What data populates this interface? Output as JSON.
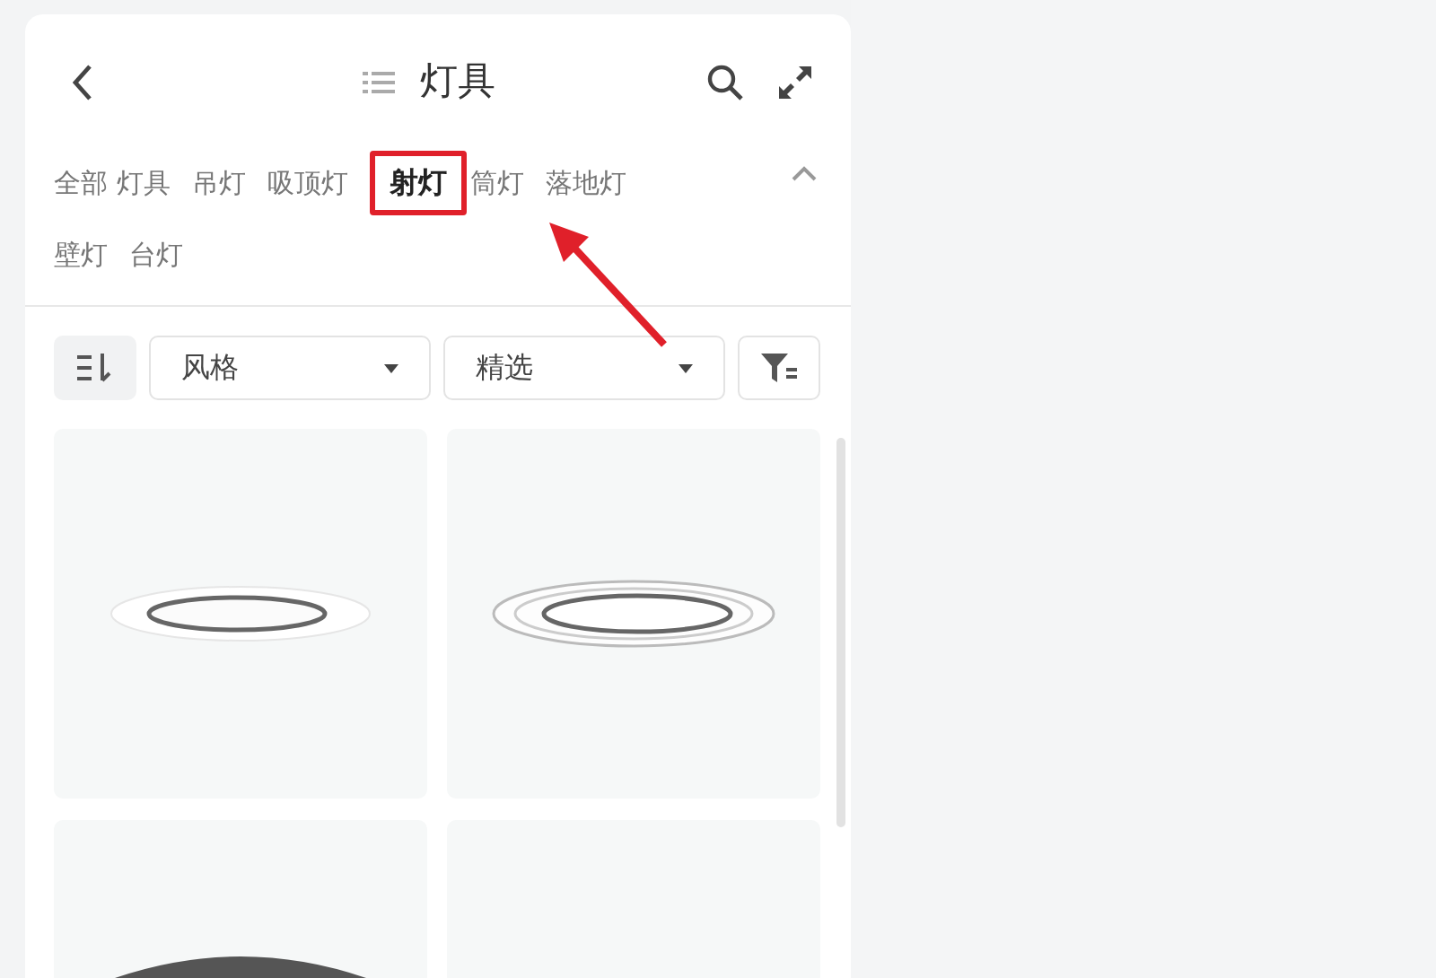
{
  "header": {
    "title": "灯具"
  },
  "categories": [
    {
      "label": "全部 灯具",
      "selected": false
    },
    {
      "label": "吊灯",
      "selected": false
    },
    {
      "label": "吸顶灯",
      "selected": false
    },
    {
      "label": "射灯",
      "selected": true
    },
    {
      "label": "筒灯",
      "selected": false
    },
    {
      "label": "落地灯",
      "selected": false
    },
    {
      "label": "壁灯",
      "selected": false
    },
    {
      "label": "台灯",
      "selected": false
    }
  ],
  "categories_expanded": true,
  "filters": [
    {
      "label": "风格"
    },
    {
      "label": "精选"
    }
  ],
  "products": [
    {
      "kind": "slim-downlight"
    },
    {
      "kind": "ring-downlight"
    },
    {
      "kind": "cylinder-light"
    },
    {
      "kind": "blank"
    }
  ]
}
